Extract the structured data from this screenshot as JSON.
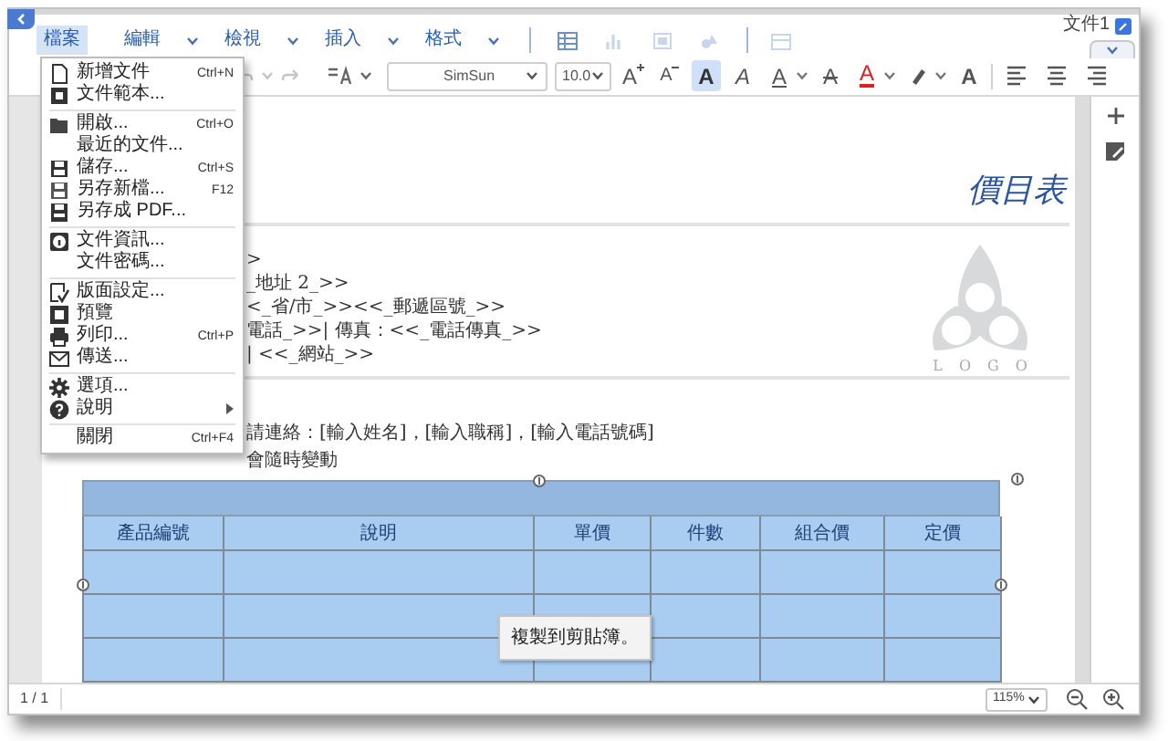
{
  "window": {
    "document_title": "文件1"
  },
  "menu_bar": [
    {
      "label": "檔案",
      "selected": true,
      "caret": false
    },
    {
      "label": "編輯",
      "selected": false,
      "caret": true
    },
    {
      "label": "檢視",
      "selected": false,
      "caret": true
    },
    {
      "label": "插入",
      "selected": false,
      "caret": true
    },
    {
      "label": "格式",
      "selected": false,
      "caret": true
    }
  ],
  "file_menu": {
    "groups": [
      [
        {
          "label": "新增文件",
          "shortcut": "Ctrl+N",
          "submenu": false
        },
        {
          "label": "文件範本...",
          "submenu": false
        }
      ],
      [
        {
          "label": "開啟...",
          "shortcut": "Ctrl+O",
          "submenu": false
        },
        {
          "label": "最近的文件...",
          "submenu": false
        },
        {
          "label": "儲存...",
          "shortcut": "Ctrl+S",
          "submenu": false
        },
        {
          "label": "另存新檔...",
          "shortcut": "F12",
          "submenu": false
        },
        {
          "label": "另存成 PDF...",
          "submenu": false
        }
      ],
      [
        {
          "label": "文件資訊...",
          "submenu": false
        },
        {
          "label": "文件密碼...",
          "submenu": false
        }
      ],
      [
        {
          "label": "版面設定...",
          "submenu": false
        },
        {
          "label": "預覽",
          "submenu": false
        },
        {
          "label": "列印...",
          "shortcut": "Ctrl+P",
          "submenu": false
        },
        {
          "label": "傳送...",
          "submenu": false
        }
      ],
      [
        {
          "label": "選項...",
          "submenu": false
        },
        {
          "label": "說明",
          "submenu": true
        }
      ],
      [
        {
          "label": "關閉",
          "shortcut": "Ctrl+F4",
          "submenu": false
        }
      ]
    ]
  },
  "toolbar": {
    "font": "SimSun",
    "font_size": "10.0",
    "buttons": [
      {
        "kind": "grow",
        "glyph": "A",
        "selected": false,
        "caret": false
      },
      {
        "kind": "shrink",
        "glyph": "A",
        "selected": false,
        "caret": false
      },
      {
        "kind": "bold",
        "glyph": "A",
        "selected": true,
        "caret": false
      },
      {
        "kind": "italic",
        "glyph": "A",
        "selected": false,
        "caret": false
      },
      {
        "kind": "underline",
        "glyph": "A",
        "selected": false,
        "caret": true
      },
      {
        "kind": "strike",
        "glyph": "A",
        "selected": false,
        "caret": false
      },
      {
        "kind": "color",
        "glyph": "A",
        "selected": false,
        "caret": true
      },
      {
        "kind": "highlight",
        "selected": false,
        "caret": true
      },
      {
        "kind": "plain",
        "glyph": "A",
        "selected": false,
        "caret": false
      }
    ]
  },
  "document": {
    "title": "價目表",
    "address_lines": [
      ">",
      "_地址 2_>>",
      "<_省/市_>><<_郵遞區號_>>",
      "電話_>>| 傳真：<<_電話傳真_>>",
      "| <<_網站_>>"
    ],
    "logo_text": "LOGO",
    "contact_line": "請連絡：[輸入姓名]，[輸入職稱]，[輸入電話號碼]",
    "note_line": "會隨時變動"
  },
  "table": {
    "columns": [
      "產品編號",
      "說明",
      "單價",
      "件數",
      "組合價",
      "定價"
    ]
  },
  "tooltip": "複製到剪貼簿。",
  "status_bar": {
    "page": "1 / 1",
    "zoom": "115%"
  }
}
